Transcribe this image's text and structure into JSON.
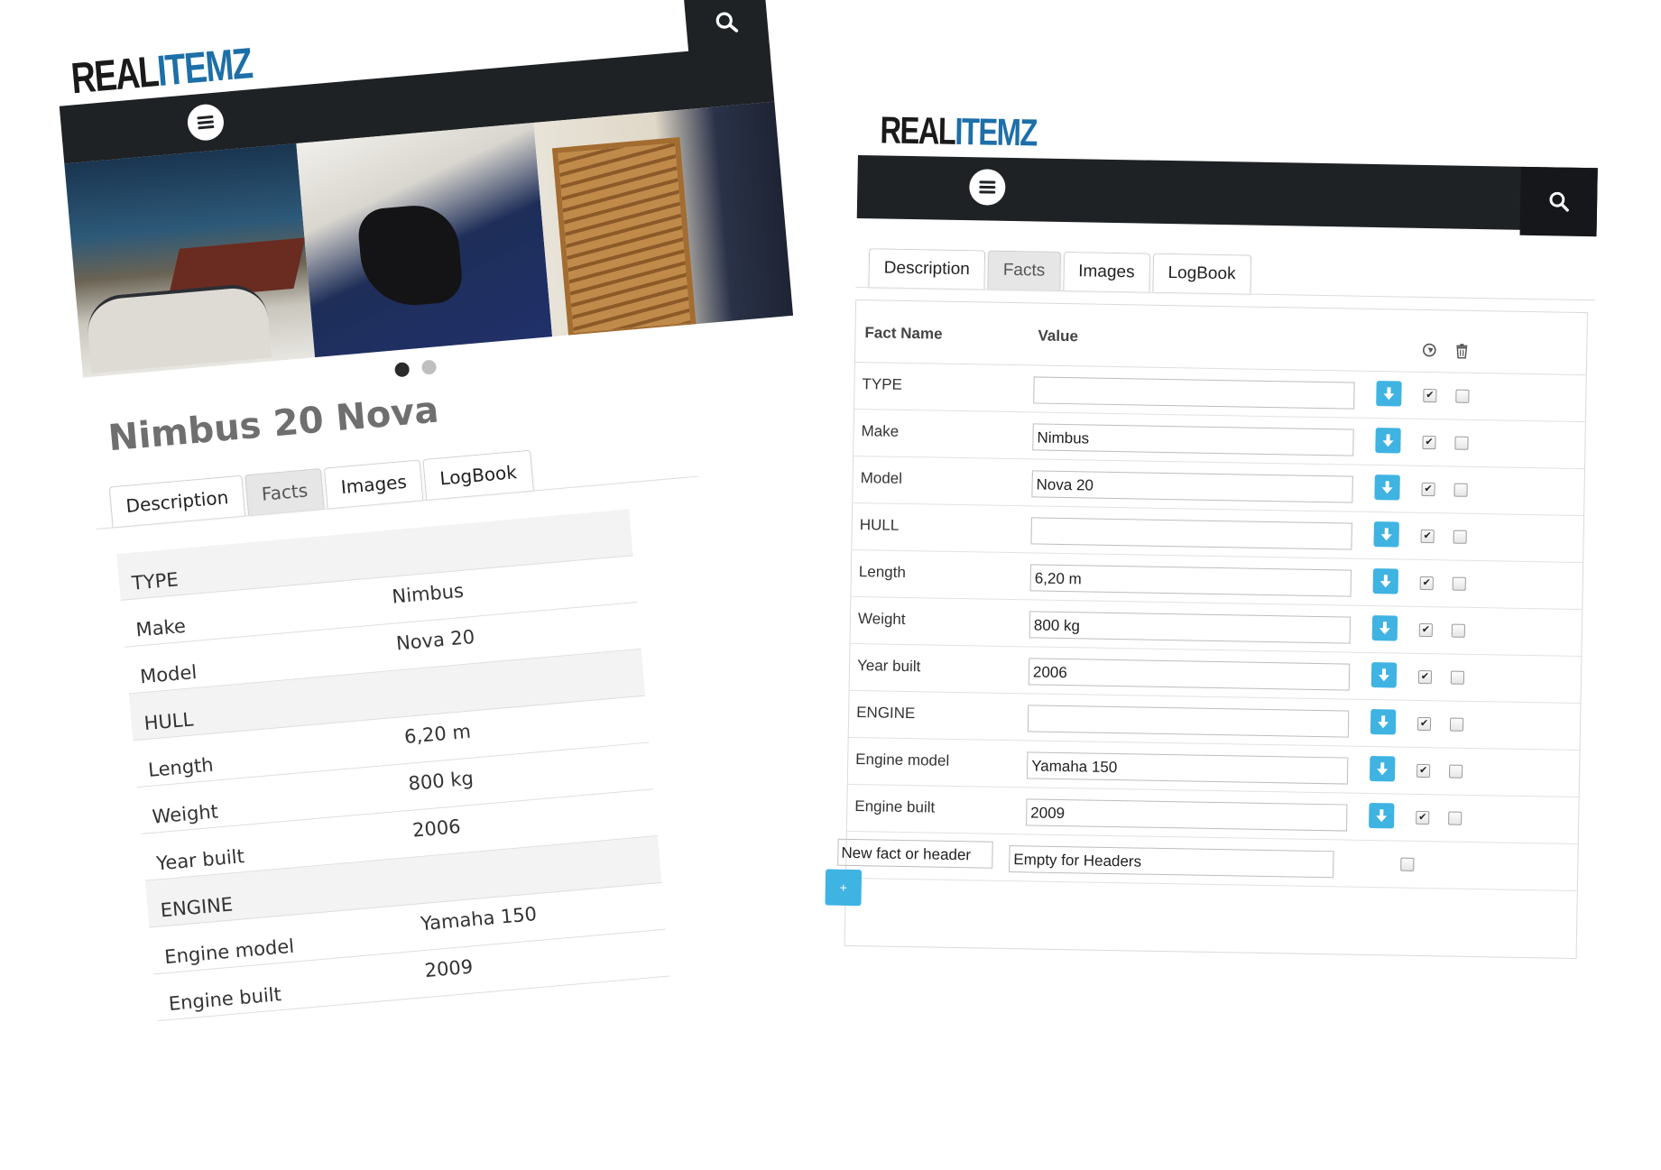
{
  "brand": {
    "part1": "REAL",
    "part2": "ITEMZ"
  },
  "left": {
    "title": "Nimbus 20 Nova",
    "tabs": [
      {
        "label": "Description",
        "active": false
      },
      {
        "label": "Facts",
        "active": true
      },
      {
        "label": "Images",
        "active": false
      },
      {
        "label": "LogBook",
        "active": false
      }
    ],
    "carousel": {
      "slides": 2,
      "current": 1
    },
    "facts": [
      {
        "name": "TYPE",
        "value": "",
        "header": true
      },
      {
        "name": "Make",
        "value": "Nimbus",
        "header": false
      },
      {
        "name": "Model",
        "value": "Nova 20",
        "header": false
      },
      {
        "name": "HULL",
        "value": "",
        "header": true
      },
      {
        "name": "Length",
        "value": "6,20 m",
        "header": false
      },
      {
        "name": "Weight",
        "value": "800 kg",
        "header": false
      },
      {
        "name": "Year built",
        "value": "2006",
        "header": false
      },
      {
        "name": "ENGINE",
        "value": "",
        "header": true
      },
      {
        "name": "Engine model",
        "value": "Yamaha 150",
        "header": false
      },
      {
        "name": "Engine built",
        "value": "2009",
        "header": false
      }
    ]
  },
  "right": {
    "tabs": [
      {
        "label": "Description",
        "active": false
      },
      {
        "label": "Facts",
        "active": true
      },
      {
        "label": "Images",
        "active": false
      },
      {
        "label": "LogBook",
        "active": false
      }
    ],
    "columns": {
      "name": "Fact Name",
      "value": "Value"
    },
    "rows": [
      {
        "name": "TYPE",
        "value": "",
        "public": true,
        "delete": false
      },
      {
        "name": "Make",
        "value": "Nimbus",
        "public": true,
        "delete": false
      },
      {
        "name": "Model",
        "value": "Nova 20",
        "public": true,
        "delete": false
      },
      {
        "name": "HULL",
        "value": "",
        "public": true,
        "delete": false
      },
      {
        "name": "Length",
        "value": "6,20 m",
        "public": true,
        "delete": false
      },
      {
        "name": "Weight",
        "value": "800 kg",
        "public": true,
        "delete": false
      },
      {
        "name": "Year built",
        "value": "2006",
        "public": true,
        "delete": false
      },
      {
        "name": "ENGINE",
        "value": "",
        "public": true,
        "delete": false
      },
      {
        "name": "Engine model",
        "value": "Yamaha 150",
        "public": true,
        "delete": false
      },
      {
        "name": "Engine built",
        "value": "2009",
        "public": true,
        "delete": false
      }
    ],
    "new_row": {
      "name_value": "New fact or header",
      "value_value": "Empty for Headers"
    },
    "add_label": "+"
  },
  "colors": {
    "navbar": "#1f2225",
    "accent": "#3fb3e2",
    "brand_blue": "#1d6fa8"
  },
  "icons": [
    "search-icon",
    "menu-icon",
    "globe-icon",
    "trash-icon",
    "arrow-down-icon",
    "checkbox",
    "plus-icon"
  ]
}
